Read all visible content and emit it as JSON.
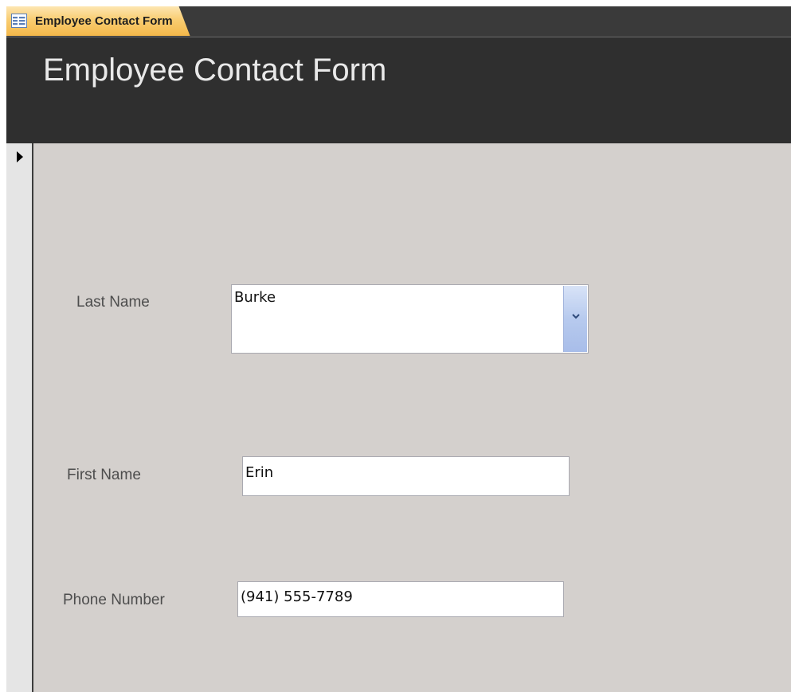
{
  "tab": {
    "icon": "form-icon",
    "label": "Employee Contact Form"
  },
  "form": {
    "title": "Employee Contact Form",
    "record_selector_icon": "current-record-arrow-icon",
    "fields": {
      "last_name": {
        "label": "Last Name",
        "value": "Burke",
        "control": "combo-box",
        "dropdown_icon": "chevron-down-icon"
      },
      "first_name": {
        "label": "First Name",
        "value": "Erin",
        "control": "text-box"
      },
      "phone_number": {
        "label": "Phone Number",
        "value": "(941) 555-7789",
        "control": "text-box"
      }
    }
  },
  "colors": {
    "header_background": "#2f2f2f",
    "detail_background": "#d4d0cd",
    "active_tab": "#f9cd72",
    "combo_button": "#b7caee"
  }
}
